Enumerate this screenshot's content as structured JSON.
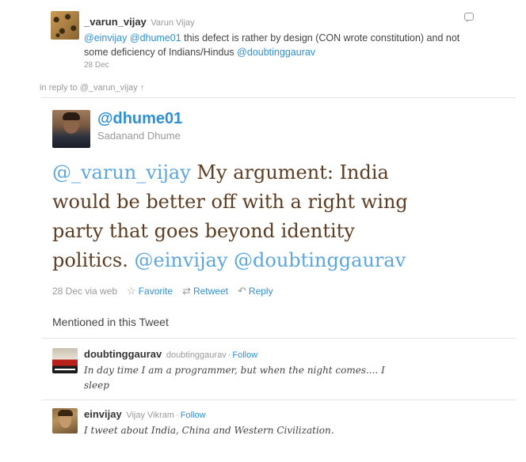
{
  "reply_tweet": {
    "username": "_varun_vijay",
    "real_name": "Varun Vijay",
    "mention_1": "@einvijay",
    "mention_2": "@dhume01",
    "text": " this defect is rather by design (CON wrote constitution) and not some deficiency of Indians/Hindus ",
    "mention_3": "@doubtinggaurav",
    "date": "28 Dec"
  },
  "in_reply_to": "in reply to @_varun_vijay ↑",
  "main_tweet": {
    "screen_name": "@dhume01",
    "real_name": "Sadanand Dhume",
    "mention_lead": "@_varun_vijay",
    "text": " My argument: India would be better off with a right wing party that goes beyond identity politics. ",
    "mention_a": "@einvijay",
    "mention_b": "@doubtinggaurav",
    "date_via": "28 Dec via web",
    "favorite_label": "Favorite",
    "retweet_label": "Retweet",
    "reply_label": "Reply"
  },
  "mentioned_heading": "Mentioned in this Tweet",
  "mentioned_users": [
    {
      "username": "doubtinggaurav",
      "real_name": "doubtinggaurav",
      "follow_label": "Follow",
      "bio": "In day time I am a programmer, but when the night comes.... I sleep"
    },
    {
      "username": "einvijay",
      "real_name": "Vijay Vikram",
      "follow_label": "Follow",
      "bio": "I tweet about India, China and Western Civilization."
    }
  ],
  "icons": {
    "favorite": "star-icon",
    "retweet": "retweet-icon",
    "reply": "reply-arrow-icon",
    "reply_bubble": "speech-bubble-icon"
  },
  "colors": {
    "link": "#2f8fd2",
    "tweet_text": "#5c3d22",
    "muted": "#999999"
  }
}
